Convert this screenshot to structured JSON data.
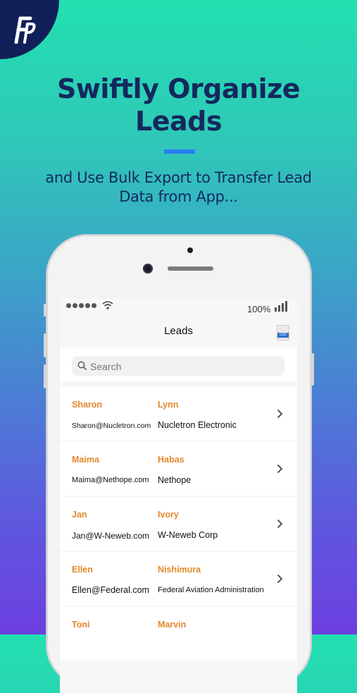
{
  "promo": {
    "headline_line1": "Swiftly Organize",
    "headline_line2": "Leads",
    "subline_line1": "and Use Bulk Export to Transfer Lead",
    "subline_line2": "Data from App..."
  },
  "status_bar": {
    "battery": "100%"
  },
  "nav": {
    "title": "Leads",
    "export_icon_label": "CSV"
  },
  "search": {
    "placeholder": "Search"
  },
  "leads": [
    {
      "first": "Sharon",
      "last": "Lynn",
      "email": "Sharon@Nucletron.com",
      "company": "Nucletron Electronic"
    },
    {
      "first": "Maima",
      "last": "Habas",
      "email": "Maima@Nethope.com",
      "company": "Nethope"
    },
    {
      "first": "Jan",
      "last": "Ivory",
      "email": "Jan@W-Neweb.com",
      "company": "W-Neweb Corp"
    },
    {
      "first": "Ellen",
      "last": "Nishimura",
      "email": "Ellen@Federal.com",
      "company": "Federal Aviation Administration"
    },
    {
      "first": "Toni",
      "last": "Marvin",
      "email": "",
      "company": ""
    }
  ],
  "colors": {
    "brand_navy": "#15285e",
    "accent_blue": "#2a7df0",
    "name_orange": "#e3892a"
  },
  "icons": [
    "fp-logo-icon",
    "wifi-icon",
    "signal-bars-icon",
    "csv-export-icon",
    "search-icon",
    "chevron-right-icon"
  ]
}
